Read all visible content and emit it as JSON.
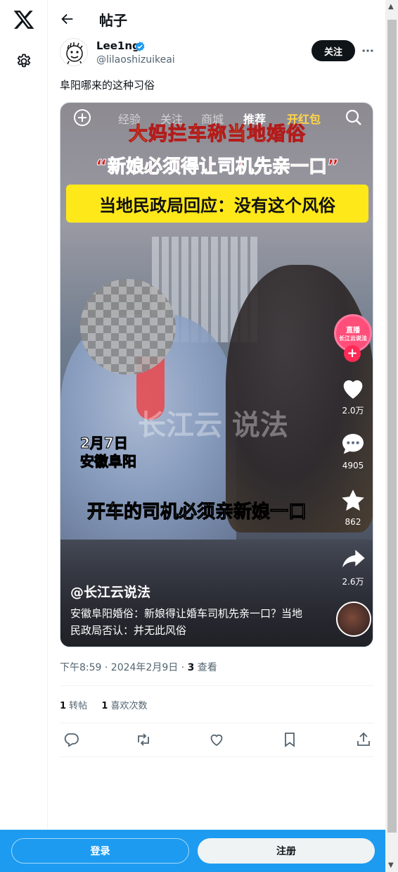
{
  "header": {
    "title": "帖子"
  },
  "author": {
    "display_name": "Lee1ng",
    "handle": "@lilaoshizuikeai",
    "follow_label": "关注"
  },
  "post": {
    "text": "阜阳哪来的这种习俗",
    "media": {
      "top_tabs": [
        "经验",
        "关注",
        "商城",
        "推荐",
        "开红包"
      ],
      "active_tab": "推荐",
      "headline_1": "大妈拦车称当地婚俗",
      "headline_2": "“新娘必须得让司机先亲一口”",
      "headline_3": "当地民政局回应：没有这个风俗",
      "watermark": "长江云 说法",
      "date_line": "2月7日",
      "location_line": "安徽阜阳",
      "subtitle": "开车的司机必须亲新娘一口",
      "live_badge_top": "直播",
      "live_badge_bottom": "长江云说法",
      "like_count": "2.0万",
      "comment_count": "4905",
      "favorite_count": "862",
      "share_count": "2.6万",
      "account_tag": "@长江云说法",
      "caption": "安徽阜阳婚俗：新娘得让婚车司机先亲一口？当地民政局否认：并无此风俗"
    },
    "timestamp": "下午8:59 · 2024年2月9日 · ",
    "views_count": "3",
    "views_label": " 查看"
  },
  "stats": {
    "retweets_count": "1",
    "retweets_label": " 转帖",
    "likes_count": "1",
    "likes_label": " 喜欢次数"
  },
  "bottom_bar": {
    "login_label": "登录",
    "signup_label": "注册"
  },
  "colors": {
    "accent": "#1d9bf0",
    "text_primary": "#0f1419",
    "text_secondary": "#536471",
    "verified": "#1d9bf0"
  },
  "icons": [
    "x-logo-icon",
    "gear-icon",
    "back-arrow-icon",
    "verified-icon",
    "more-icon",
    "reply-icon",
    "retweet-icon",
    "like-icon",
    "bookmark-icon",
    "share-icon"
  ]
}
